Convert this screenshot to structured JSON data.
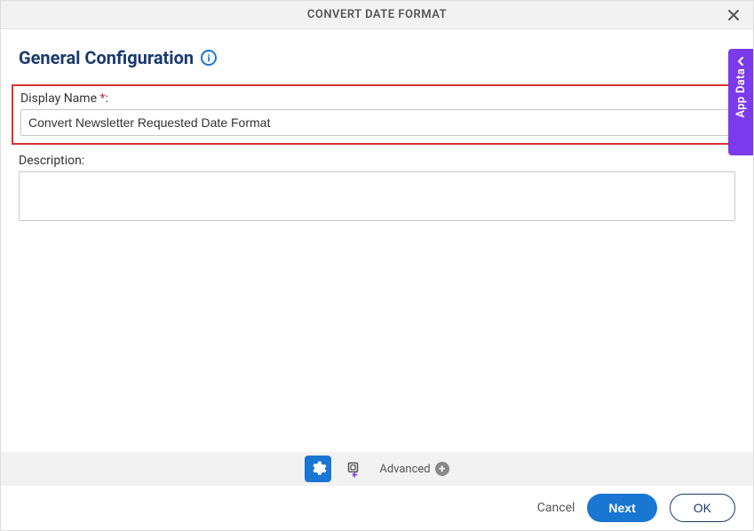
{
  "header": {
    "title": "CONVERT DATE FORMAT"
  },
  "section": {
    "heading": "General Configuration"
  },
  "fields": {
    "display_name": {
      "label": "Display Name",
      "required_colon": ":",
      "value": "Convert Newsletter Requested Date Format"
    },
    "description": {
      "label": "Description:",
      "value": ""
    }
  },
  "toolbar": {
    "advanced_label": "Advanced"
  },
  "footer": {
    "cancel": "Cancel",
    "next": "Next",
    "ok": "OK"
  },
  "side_tab": {
    "label": "App Data"
  }
}
